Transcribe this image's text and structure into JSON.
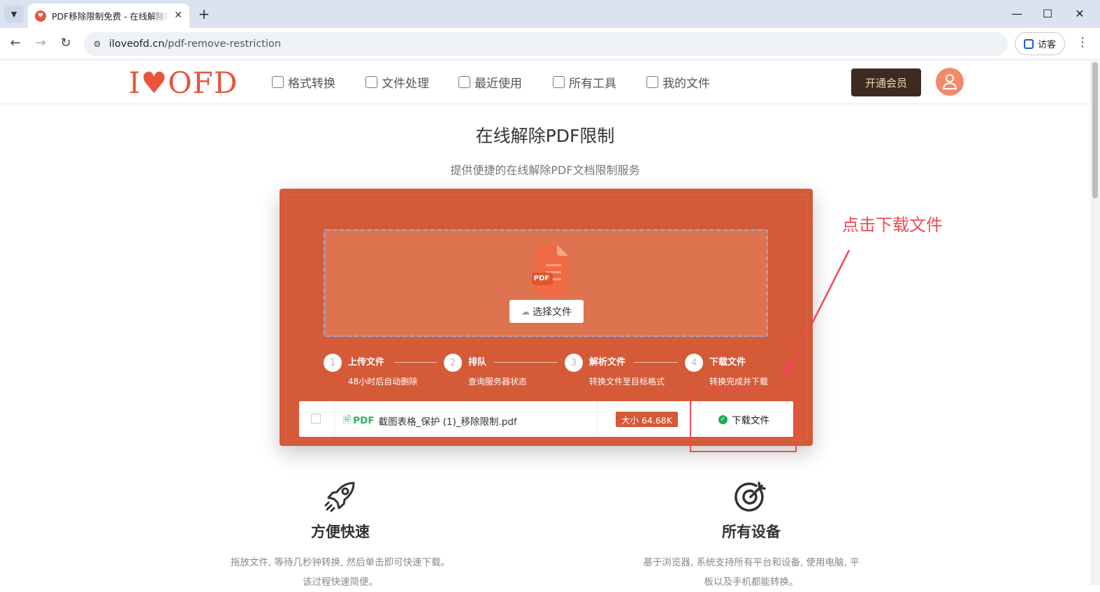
{
  "browser": {
    "tab_title": "PDF移除限制免费 - 在线解除PDF限制",
    "url_host": "iloveofd.cn",
    "url_path": "/pdf-remove-restriction",
    "guest_label": "访客"
  },
  "site": {
    "logo_text": "I♥OFD",
    "nav": [
      {
        "label": "格式转换",
        "icon": "convert-icon"
      },
      {
        "label": "文件处理",
        "icon": "file-edit-icon"
      },
      {
        "label": "最近使用",
        "icon": "recent-icon"
      },
      {
        "label": "所有工具",
        "icon": "grid-icon"
      },
      {
        "label": "我的文件",
        "icon": "my-files-icon"
      }
    ],
    "vip_label": "开通会员"
  },
  "hero": {
    "title": "在线解除PDF限制",
    "subtitle": "提供便捷的在线解除PDF文档限制服务"
  },
  "upload": {
    "pdf_badge": "PDF",
    "choose_label": "选择文件"
  },
  "steps": [
    {
      "num": "1",
      "name": "上传文件",
      "desc": "48小时后自动删除"
    },
    {
      "num": "2",
      "name": "排队",
      "desc": "查询服务器状态"
    },
    {
      "num": "3",
      "name": "解析文件",
      "desc": "转换文件至目标格式"
    },
    {
      "num": "4",
      "name": "下载文件",
      "desc": "转换完成并下载"
    }
  ],
  "file": {
    "type_tag": "PDF",
    "name": "截图表格_保护 (1)_移除限制.pdf",
    "size": "大小 64.68K",
    "download_label": "下载文件"
  },
  "annotation": {
    "text": "点击下载文件",
    "color": "#f04a52"
  },
  "features": [
    {
      "icon": "rocket-icon",
      "title": "方便快速",
      "desc": "拖放文件, 等待几秒钟转换, 然后单击即可快速下载。该过程快速简便。"
    },
    {
      "icon": "target-icon",
      "title": "所有设备",
      "desc": "基于浏览器, 系统支持所有平台和设备, 使用电脑, 平板以及手机都能转换。"
    }
  ],
  "colors": {
    "brand": "#e8553a",
    "tool_bg": "#d45a38",
    "drop_bg": "#de744f",
    "vip_bg": "#3d2b22",
    "success": "#1aad55"
  }
}
